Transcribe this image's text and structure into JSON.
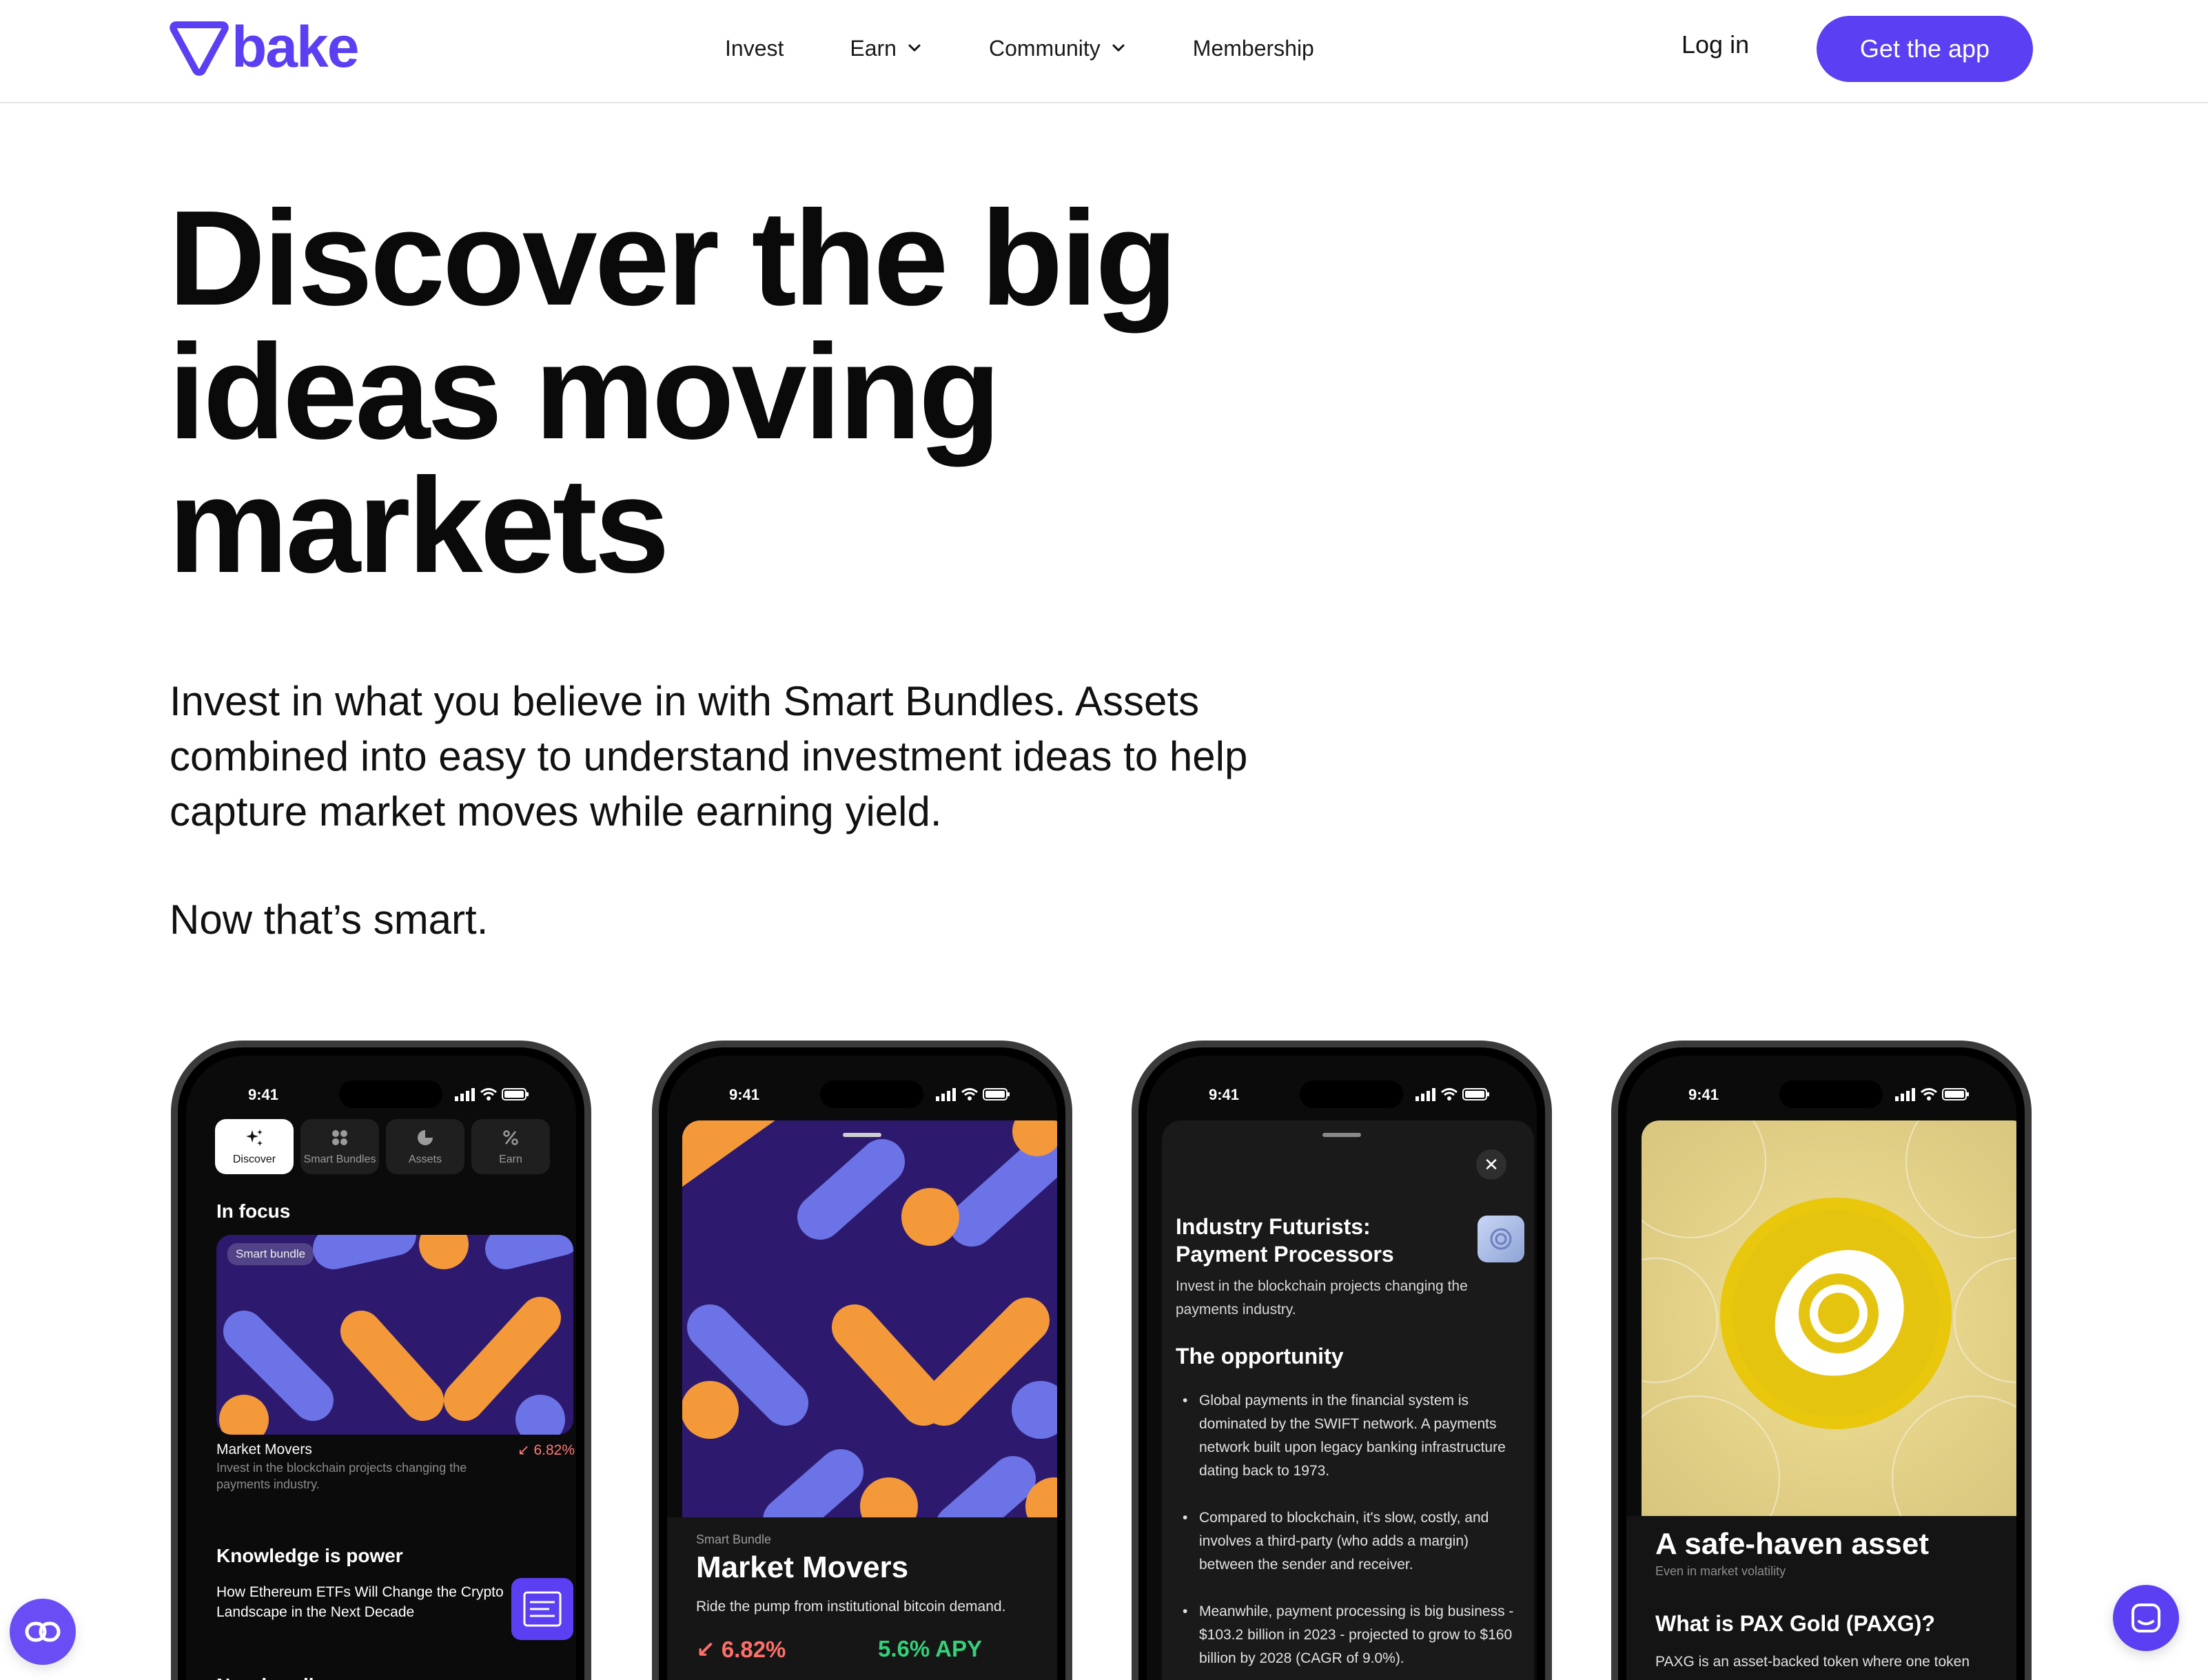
{
  "brand": {
    "name": "bake",
    "accent": "#5b3ff2"
  },
  "nav": {
    "items": [
      {
        "label": "Invest",
        "dropdown": false
      },
      {
        "label": "Earn",
        "dropdown": true
      },
      {
        "label": "Community",
        "dropdown": true
      },
      {
        "label": "Membership",
        "dropdown": false
      }
    ],
    "login_label": "Log in",
    "cta_label": "Get the app"
  },
  "hero": {
    "title_lines": [
      "Discover the big",
      "ideas moving",
      "markets"
    ],
    "subtitle_lines": [
      "Invest in what you believe in with Smart Bundles. Assets",
      "combined into easy to understand investment ideas to help",
      "capture market moves while earning yield."
    ],
    "tagline": "Now that’s smart."
  },
  "phones": {
    "status_time": "9:41",
    "discover": {
      "tabs": [
        {
          "label": "Discover",
          "icon": "sparkles-icon",
          "active": true
        },
        {
          "label": "Smart Bundles",
          "icon": "grid-dots-icon",
          "active": false
        },
        {
          "label": "Assets",
          "icon": "pie-icon",
          "active": false
        },
        {
          "label": "Earn",
          "icon": "percent-icon",
          "active": false
        }
      ],
      "in_focus": "In focus",
      "card_badge": "Smart bundle",
      "card_title": "Market Movers",
      "card_change": "↙ 6.82%",
      "card_desc": "Invest in the blockchain projects changing the payments industry.",
      "knowledge_heading": "Knowledge is power",
      "knowledge_text": "How Ethereum ETFs Will Change the Crypto Landscape in the Next Decade",
      "new_bundles": "New bundles"
    },
    "bundle": {
      "kicker": "Smart Bundle",
      "title": "Market Movers",
      "desc": "Ride the pump from institutional bitcoin demand.",
      "change": "↙ 6.82%",
      "apy": "5.6% APY"
    },
    "detail": {
      "close": "✕",
      "title_lines": [
        "Industry Futurists:",
        "Payment Processors"
      ],
      "desc": "Invest in the blockchain projects changing the payments industry.",
      "heading": "The opportunity",
      "bullets": [
        "Global payments in the financial system is dominated by the SWIFT network. A payments network built upon legacy banking infrastructure dating back to 1973.",
        "Compared to blockchain, it's slow, costly, and involves a third-party (who adds a margin) between the sender and receiver.",
        "Meanwhile, payment processing is big business - $103.2 billion in 2023 - projected to grow to $160 billion by 2028 (CAGR of 9.0%)."
      ]
    },
    "asset": {
      "title": "A safe-haven asset",
      "subtitle": "Even in market volatility",
      "heading": "What is PAX Gold (PAXG)?",
      "desc": "PAXG is an asset-backed token where one token"
    }
  },
  "floating": {
    "left_icon": "link-icon",
    "right_icon": "chat-icon"
  }
}
